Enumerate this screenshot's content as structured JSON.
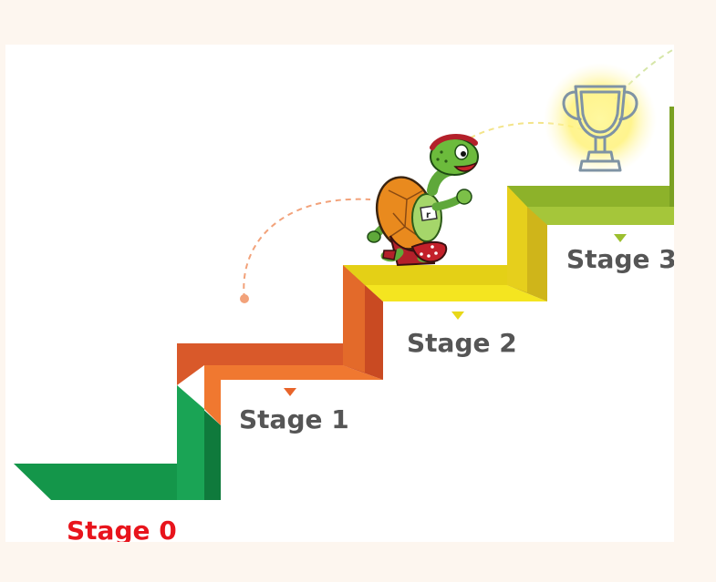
{
  "stages": [
    {
      "label": "Stage 0",
      "color": "#1a9a4a",
      "label_color": "#e8141c"
    },
    {
      "label": "Stage 1",
      "color": "#e8642a",
      "label_color": "#555555"
    },
    {
      "label": "Stage 2",
      "color": "#f0e020",
      "label_color": "#555555"
    },
    {
      "label": "Stage 3",
      "color": "#9cbf2e",
      "label_color": "#555555"
    }
  ],
  "icons": {
    "runner": "turtle-runner-icon",
    "goal": "trophy-icon"
  },
  "colors": {
    "background": "#fdf6ef",
    "panel": "#ffffff",
    "trophy_glow": "#fff27a"
  }
}
